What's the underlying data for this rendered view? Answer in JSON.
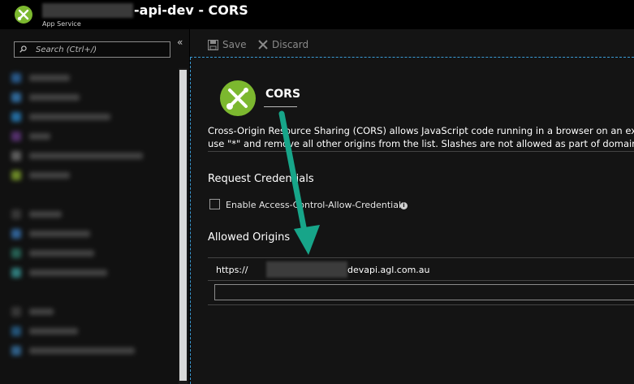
{
  "header": {
    "title": "-api-dev - CORS",
    "subtitle": "App Service"
  },
  "sidebar": {
    "search_placeholder": "Search (Ctrl+/)",
    "collapse_icon": "double-chevron-left-icon"
  },
  "toolbar": {
    "save_label": "Save",
    "discard_label": "Discard"
  },
  "blade": {
    "title": "CORS",
    "description_line1": "Cross-Origin Resource Sharing (CORS) allows JavaScript code running in a browser on an exter",
    "description_line2": "use \"*\" and remove all other origins from the list. Slashes are not allowed as part of domain or",
    "request_credentials_heading": "Request Credentials",
    "enable_credentials_label": "Enable Access-Control-Allow-Credentials",
    "allowed_origins_heading": "Allowed Origins",
    "origins": [
      {
        "prefix": "https://",
        "suffix": "devapi.agl.com.au"
      }
    ],
    "new_origin_value": ""
  },
  "colors": {
    "brand_green": "#7cb82f",
    "annotation_arrow": "#17a589",
    "focus_border": "#3a9bd5"
  }
}
